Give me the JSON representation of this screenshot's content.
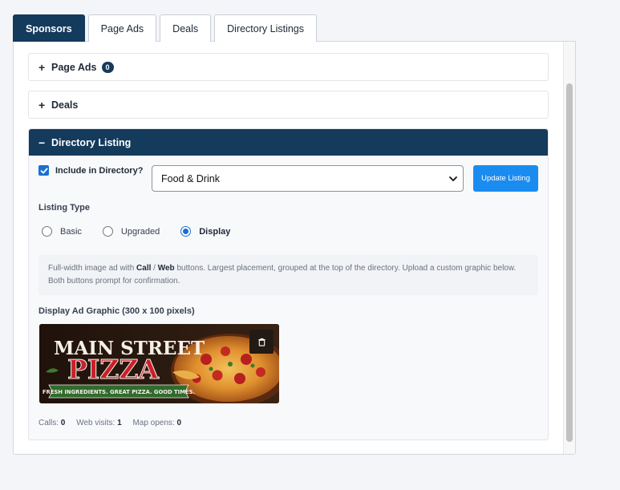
{
  "tabs": [
    "Sponsors",
    "Page Ads",
    "Deals",
    "Directory Listings"
  ],
  "sections": {
    "page_ads": {
      "label": "Page Ads",
      "count": "0",
      "sign": "+"
    },
    "deals": {
      "label": "Deals",
      "sign": "+"
    },
    "directory": {
      "label": "Directory Listing",
      "sign": "−"
    }
  },
  "directory_listing": {
    "include_label": "Include in Directory?",
    "include_checked": true,
    "category_value": "Food & Drink",
    "update_button": "Update Listing",
    "listing_type_label": "Listing Type",
    "listing_types": [
      "Basic",
      "Upgraded",
      "Display"
    ],
    "selected_type": "Display",
    "info": {
      "part1": "Full-width image ad with ",
      "call": "Call",
      "slash": " / ",
      "web": "Web",
      "part2": " buttons. Largest placement, grouped at the top of the directory. Upload a custom graphic below. Both buttons prompt for confirmation."
    },
    "graphic_label": "Display Ad Graphic (300 x 100 pixels)",
    "ad_graphic": {
      "line1": "MAIN STREET",
      "line2": "PIZZA",
      "tagline": "FRESH INGREDIENTS. GREAT PIZZA. GOOD TIMES."
    },
    "stats": {
      "calls_label": "Calls:",
      "calls": "0",
      "web_label": "Web visits:",
      "web": "1",
      "map_label": "Map opens:",
      "map": "0"
    }
  },
  "colors": {
    "navy": "#143a5c",
    "accent_blue": "#1a8cf0",
    "pizza_red": "#c8202a",
    "banner_green": "#2f6b2d"
  },
  "icons": [
    "check-icon",
    "chevron-down-icon",
    "trash-icon"
  ]
}
